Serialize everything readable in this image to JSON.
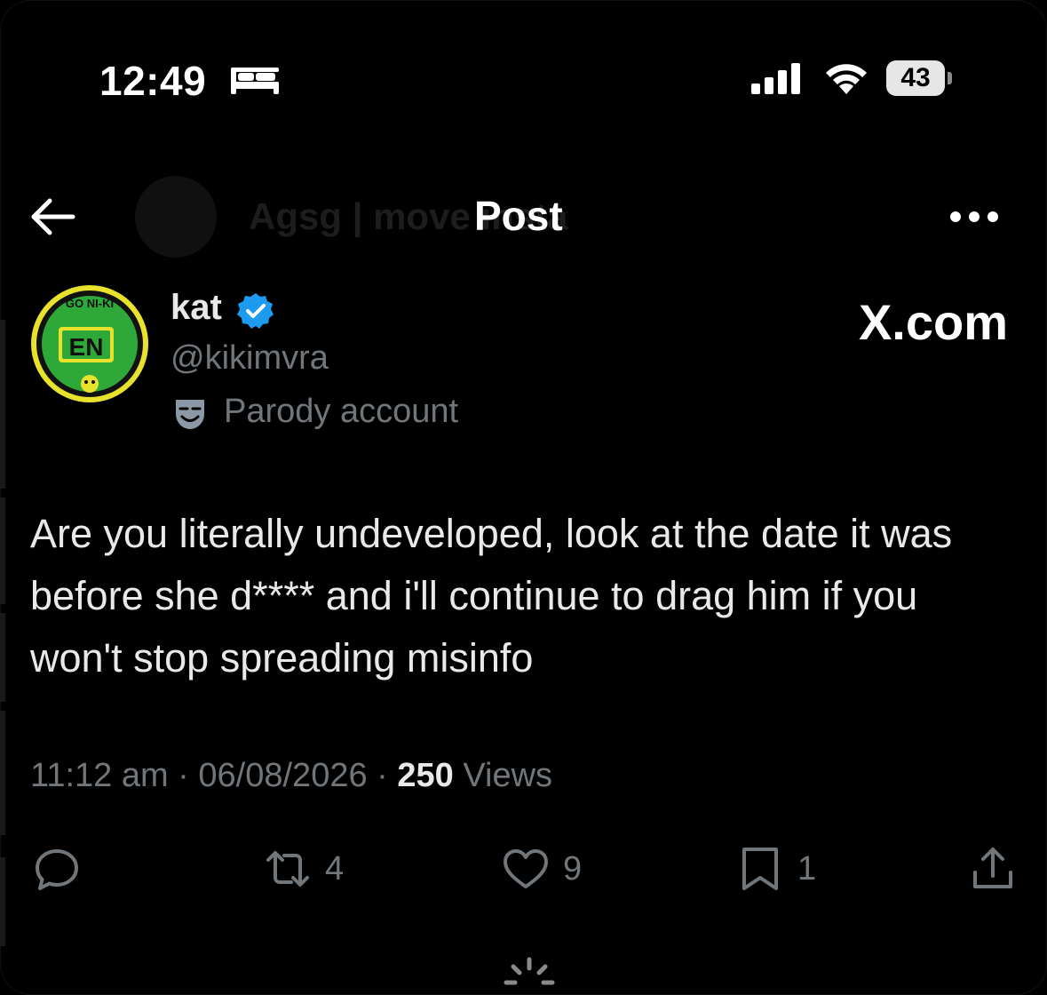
{
  "status_bar": {
    "time": "12:49",
    "sleep_icon": "bed-icon",
    "battery_level": "43"
  },
  "header": {
    "title": "Post",
    "background_name": "Agsg | move insta"
  },
  "author": {
    "display_name": "kat",
    "handle": "@kikimvra",
    "parody_label": "Parody account",
    "avatar_text_top": "GO NI-KI",
    "avatar_text_center": "EN"
  },
  "watermark": "X.com",
  "tweet": {
    "text": "Are you literally undeveloped, look at the date it was before she d**** and i'll continue to drag him if you won't stop spreading misinfo",
    "time": "11:12 am",
    "date": "06/08/2026",
    "separator": " · ",
    "views_count": "250",
    "views_label": "Views"
  },
  "actions": {
    "reposts": "4",
    "likes": "9",
    "bookmarks": "1"
  },
  "colors": {
    "background": "#000000",
    "text": "#e7e9ea",
    "secondary": "#71767b",
    "verified": "#1d9bf0"
  }
}
